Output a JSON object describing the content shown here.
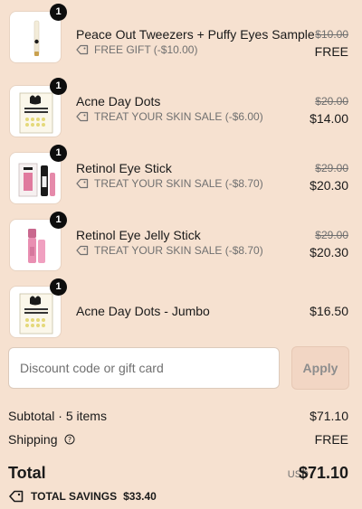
{
  "items": [
    {
      "qty": "1",
      "name": "Peace Out Tweezers + Puffy Eyes Sample",
      "discount": "FREE GIFT (-$10.00)",
      "old_price": "$10.00",
      "price": "FREE",
      "icon": "tweezers-product-image"
    },
    {
      "qty": "1",
      "name": "Acne Day Dots",
      "discount": "TREAT YOUR SKIN SALE (-$6.00)",
      "old_price": "$20.00",
      "price": "$14.00",
      "icon": "acne-dots-product-image"
    },
    {
      "qty": "1",
      "name": "Retinol Eye Stick",
      "discount": "TREAT YOUR SKIN SALE (-$8.70)",
      "old_price": "$29.00",
      "price": "$20.30",
      "icon": "eye-stick-product-image"
    },
    {
      "qty": "1",
      "name": "Retinol Eye Jelly Stick",
      "discount": "TREAT YOUR SKIN SALE (-$8.70)",
      "old_price": "$29.00",
      "price": "$20.30",
      "icon": "jelly-stick-product-image"
    },
    {
      "qty": "1",
      "name": "Acne Day Dots - Jumbo",
      "price": "$16.50",
      "icon": "acne-dots-jumbo-product-image"
    }
  ],
  "discount_code": {
    "placeholder": "Discount code or gift card",
    "apply_label": "Apply"
  },
  "summary": {
    "subtotal_label": "Subtotal · 5 items",
    "subtotal_value": "$71.10",
    "shipping_label": "Shipping",
    "shipping_value": "FREE",
    "total_label": "Total",
    "currency": "USD",
    "total_value": "$71.10",
    "savings_label": "TOTAL SAVINGS",
    "savings_value": "$33.40"
  },
  "colors": {
    "background": "#f6e1d0",
    "text": "#1a1a1a",
    "muted": "#707070",
    "badge": "#0d0d0d",
    "apply_bg": "#f2d6c4"
  }
}
